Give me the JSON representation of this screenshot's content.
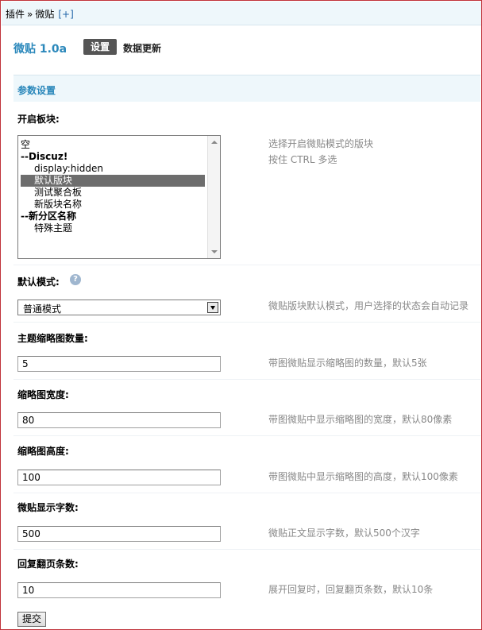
{
  "breadcrumb": {
    "items": [
      "插件",
      "微贴"
    ],
    "separator": "»",
    "add_label": "[+]"
  },
  "header": {
    "app_title": "微贴 1.0a",
    "tabs": [
      {
        "label": "设置",
        "active": true
      },
      {
        "label": "数据更新",
        "active": false
      }
    ]
  },
  "section": {
    "title": "参数设置"
  },
  "forums_field": {
    "label": "开启板块:",
    "hint_line1": "选择开启微贴模式的版块",
    "hint_line2": "按住 CTRL 多选",
    "options": [
      {
        "text": "空",
        "type": "plain"
      },
      {
        "text": "--Discuz!",
        "type": "group"
      },
      {
        "text": "display:hidden",
        "type": "child"
      },
      {
        "text": "默认版块",
        "type": "child",
        "selected": true
      },
      {
        "text": "测试聚合板",
        "type": "child"
      },
      {
        "text": "新版块名称",
        "type": "child"
      },
      {
        "text": "--新分区名称",
        "type": "group"
      },
      {
        "text": "特殊主题",
        "type": "child"
      }
    ]
  },
  "mode_field": {
    "label": "默认模式:",
    "value": "普通模式",
    "hint": "微贴版块默认模式，用户选择的状态会自动记录",
    "help_icon": "?"
  },
  "fields": [
    {
      "label": "主题缩略图数量:",
      "value": "5",
      "hint": "带图微贴显示缩略图的数量，默认5张"
    },
    {
      "label": "缩略图宽度:",
      "value": "80",
      "hint": "带图微贴中显示缩略图的宽度，默认80像素"
    },
    {
      "label": "缩略图高度:",
      "value": "100",
      "hint": "带图微贴中显示缩略图的高度，默认100像素"
    },
    {
      "label": "微贴显示字数:",
      "value": "500",
      "hint": "微贴正文显示字数，默认500个汉字"
    },
    {
      "label": "回复翻页条数:",
      "value": "10",
      "hint": "展开回复时，回复翻页条数，默认10条"
    }
  ],
  "submit_label": "提交",
  "colors": {
    "accent": "#2b88bb",
    "header_bg": "#eef7fb",
    "frame_border": "#c0323a",
    "selected_bg": "#6d6d6d"
  }
}
